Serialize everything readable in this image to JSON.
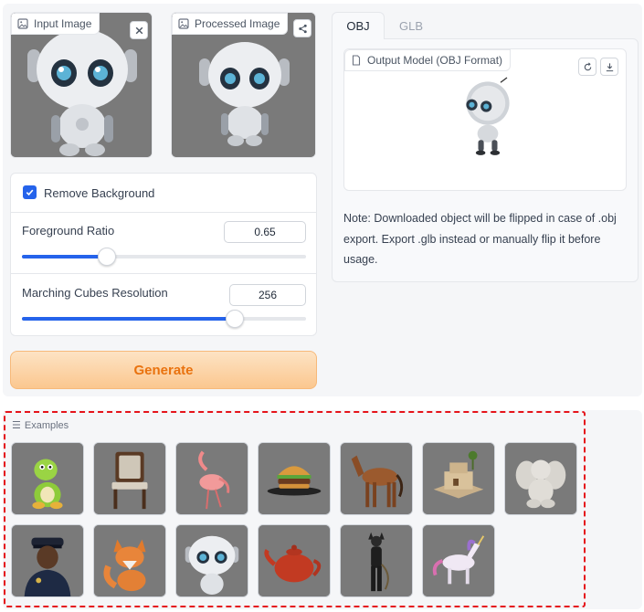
{
  "input_image": {
    "label": "Input Image",
    "clear_icon": "close-icon"
  },
  "processed_image": {
    "label": "Processed Image",
    "share_icon": "share-icon"
  },
  "controls": {
    "remove_background_label": "Remove Background",
    "remove_background_checked": true,
    "foreground_ratio": {
      "label": "Foreground Ratio",
      "value": "0.65",
      "fraction": 0.3
    },
    "mc_resolution": {
      "label": "Marching Cubes Resolution",
      "value": "256",
      "fraction": 0.75
    }
  },
  "generate_label": "Generate",
  "tabs": [
    {
      "label": "OBJ",
      "active": true
    },
    {
      "label": "GLB",
      "active": false
    }
  ],
  "output_model": {
    "label": "Output Model (OBJ Format)"
  },
  "note": "Note: Downloaded object will be flipped in case of .obj export. Export .glb instead or manually flip it before usage.",
  "examples": {
    "label": "Examples",
    "items": [
      "dinosaur",
      "chair",
      "flamingo",
      "burger",
      "horse",
      "house",
      "cherub",
      "police-officer",
      "fox",
      "robot",
      "teapot",
      "catwoman",
      "unicorn"
    ]
  },
  "colors": {
    "accent": "#2563eb",
    "generate_text": "#e9720e",
    "highlight_border": "#e5131a"
  }
}
